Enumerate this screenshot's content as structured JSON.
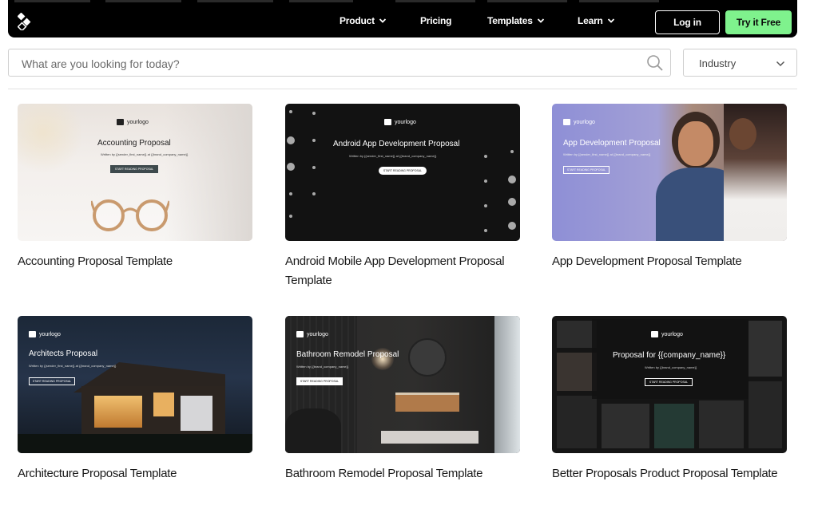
{
  "nav": {
    "items": [
      {
        "label": "Product",
        "has_dropdown": true
      },
      {
        "label": "Pricing",
        "has_dropdown": false
      },
      {
        "label": "Templates",
        "has_dropdown": true
      },
      {
        "label": "Learn",
        "has_dropdown": true
      }
    ],
    "login_label": "Log in",
    "try_label": "Try it Free"
  },
  "search": {
    "placeholder": "What are you looking for today?",
    "value": ""
  },
  "filter": {
    "industry_label": "Industry"
  },
  "colors": {
    "nav_bg": "#000000",
    "accent_green": "#7ff28d"
  },
  "templates": [
    {
      "title": "Accounting Proposal Template",
      "preview": {
        "logo": "yourlogo",
        "heading": "Accounting Proposal",
        "written": "Written by {{sender_first_name}} at {{brand_company_name}}",
        "button": "START READING PROPOSAL"
      }
    },
    {
      "title": "Android Mobile App Development Proposal Template",
      "preview": {
        "logo": "yourlogo",
        "heading": "Android App Development Proposal",
        "written": "Written by {{sender_first_name}} at {{brand_company_name}}",
        "button": "START READING PROPOSAL"
      }
    },
    {
      "title": "App Development Proposal Template",
      "preview": {
        "logo": "yourlogo",
        "heading": "App Development Proposal",
        "written": "Written by {{sender_first_name}} at {{brand_company_name}}",
        "button": "START READING PROPOSAL"
      }
    },
    {
      "title": "Architecture Proposal Template",
      "preview": {
        "logo": "yourlogo",
        "heading": "Architects Proposal",
        "written": "Written by {{sender_first_name}} at {{brand_company_name}}",
        "button": "START READING PROPOSAL"
      }
    },
    {
      "title": "Bathroom Remodel Proposal Template",
      "preview": {
        "logo": "yourlogo",
        "heading": "Bathroom Remodel Proposal",
        "written": "Written by {{brand_company_name}}",
        "button": "START READING PROPOSAL"
      }
    },
    {
      "title": "Better Proposals Product Proposal Template",
      "preview": {
        "logo": "yourlogo",
        "heading": "Proposal for {{company_name}}",
        "written": "Written by {{brand_company_name}}",
        "button": "START READING PROPOSAL"
      }
    }
  ]
}
